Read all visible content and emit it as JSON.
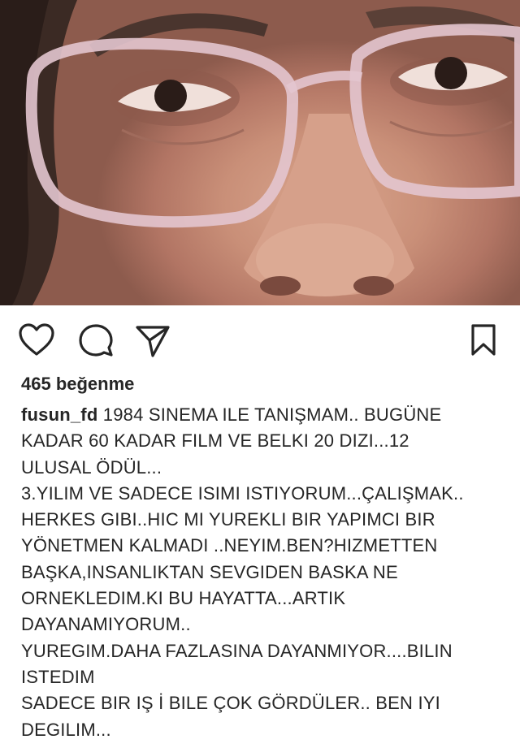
{
  "post": {
    "image_icon": "selfie-close-up-face-with-glasses",
    "likes": "465 beğenme",
    "username": "fusun_fd",
    "caption_lines": [
      "1984 SINEMA ILE TANIŞMAM.. BUGÜNE",
      "KADAR 60 KADAR FILM VE BELKI 20 DIZI...12",
      "ULUSAL ÖDÜL...",
      "3.YILIM VE SADECE ISIMI ISTIYORUM...ÇALIŞMAK..",
      "HERKES GIBI..HIC MI YUREKLI BIR YAPIMCI BIR",
      "YÖNETMEN KALMADI ..NEYIM.BEN?HIZMETTEN",
      "BAŞKA,INSANLIKTAN SEVGIDEN BASKA NE",
      "ORNEKLEDIM.KI BU HAYATTA...ARTIK",
      "DAYANAMIYORUM..",
      "YUREGIM.DAHA FAZLASINA DAYANMIYOR....BILIN",
      "ISTEDIM",
      "SADECE BIR IŞ İ BILE ÇOK GÖRDÜLER.. BEN  IYI",
      "DEGILIM..."
    ]
  },
  "actions": {
    "like_icon": "heart-icon",
    "comment_icon": "comment-icon",
    "share_icon": "send-icon",
    "save_icon": "bookmark-icon"
  },
  "colors": {
    "text": "#262626",
    "background": "#ffffff"
  }
}
